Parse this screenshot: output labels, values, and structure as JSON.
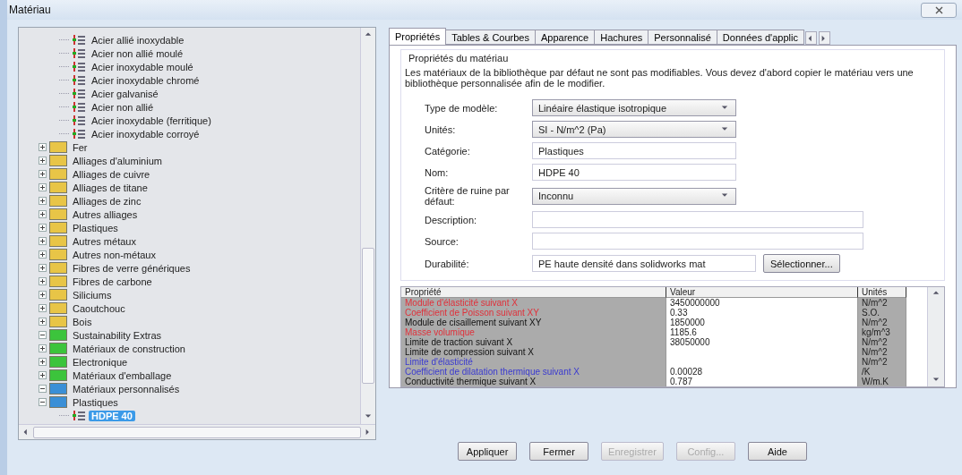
{
  "window": {
    "title": "Matériau"
  },
  "tree": [
    {
      "children": [
        {
          "children": [
            {
              "label": "Acier allié inoxydable",
              "kind": "material",
              "selected": false
            },
            {
              "label": "Acier non allié moulé",
              "kind": "material",
              "selected": false
            },
            {
              "label": "Acier inoxydable moulé",
              "kind": "material",
              "selected": false
            },
            {
              "label": "Acier inoxydable chromé",
              "kind": "material",
              "selected": false
            },
            {
              "label": "Acier galvanisé",
              "kind": "material",
              "selected": false
            },
            {
              "label": "Acier non allié",
              "kind": "material",
              "selected": false
            },
            {
              "label": "Acier inoxydable (ferritique)",
              "kind": "material",
              "selected": false
            },
            {
              "label": "Acier inoxydable corroyé",
              "kind": "material",
              "selected": false
            }
          ]
        },
        {
          "label": "Fer",
          "kind": "folder",
          "color": "#e8c547",
          "expanded": false,
          "selected": false
        },
        {
          "label": "Alliages d'aluminium",
          "kind": "folder",
          "color": "#e8c547",
          "expanded": false,
          "selected": false
        },
        {
          "label": "Alliages de cuivre",
          "kind": "folder",
          "color": "#e8c547",
          "expanded": false,
          "selected": false
        },
        {
          "label": "Alliages de titane",
          "kind": "folder",
          "color": "#e8c547",
          "expanded": false,
          "selected": false
        },
        {
          "label": "Alliages de zinc",
          "kind": "folder",
          "color": "#e8c547",
          "expanded": false,
          "selected": false
        },
        {
          "label": "Autres alliages",
          "kind": "folder",
          "color": "#e8c547",
          "expanded": false,
          "selected": false
        },
        {
          "label": "Plastiques",
          "kind": "folder",
          "color": "#e8c547",
          "expanded": false,
          "selected": false
        },
        {
          "label": "Autres métaux",
          "kind": "folder",
          "color": "#e8c547",
          "expanded": false,
          "selected": false
        },
        {
          "label": "Autres non-métaux",
          "kind": "folder",
          "color": "#e8c547",
          "expanded": false,
          "selected": false
        },
        {
          "label": "Fibres de verre génériques",
          "kind": "folder",
          "color": "#e8c547",
          "expanded": false,
          "selected": false
        },
        {
          "label": "Fibres de carbone",
          "kind": "folder",
          "color": "#e8c547",
          "expanded": false,
          "selected": false
        },
        {
          "label": "Siliciums",
          "kind": "folder",
          "color": "#e8c547",
          "expanded": false,
          "selected": false
        },
        {
          "label": "Caoutchouc",
          "kind": "folder",
          "color": "#e8c547",
          "expanded": false,
          "selected": false
        },
        {
          "label": "Bois",
          "kind": "folder",
          "color": "#e8c547",
          "expanded": false,
          "selected": false
        }
      ]
    },
    {
      "label": "Sustainability Extras",
      "kind": "folder",
      "color": "#3cc43c",
      "expanded": true,
      "selected": false,
      "children": [
        {
          "label": "Matériaux de construction",
          "kind": "folder",
          "color": "#3cc43c",
          "expanded": false,
          "selected": false
        },
        {
          "label": "Electronique",
          "kind": "folder",
          "color": "#3cc43c",
          "expanded": false,
          "selected": false
        },
        {
          "label": "Matériaux d'emballage",
          "kind": "folder",
          "color": "#3cc43c",
          "expanded": false,
          "selected": false
        }
      ]
    },
    {
      "label": "Matériaux personnalisés",
      "kind": "folder",
      "color": "#3a8fd6",
      "expanded": true,
      "selected": false,
      "children": [
        {
          "label": "Plastiques",
          "kind": "folder",
          "color": "#3a8fd6",
          "expanded": true,
          "selected": false,
          "children": [
            {
              "label": "HDPE 40",
              "kind": "material",
              "selected": true
            }
          ]
        }
      ]
    }
  ],
  "tabs": [
    {
      "label": "Propriétés",
      "selected": true
    },
    {
      "label": "Tables & Courbes",
      "selected": false
    },
    {
      "label": "Apparence",
      "selected": false
    },
    {
      "label": "Hachures",
      "selected": false
    },
    {
      "label": "Personnalisé",
      "selected": false
    },
    {
      "label": "Données d'applic",
      "selected": false
    }
  ],
  "group": {
    "title": "Propriétés du matériau",
    "note": "Les matériaux de la bibliothèque par défaut ne sont pas modifiables. Vous devez d'abord copier le matériau vers une bibliothèque personnalisée afin de le modifier."
  },
  "fields": [
    {
      "label": "Type de modèle:",
      "kind": "dropdown",
      "value": "Linéaire élastique isotropique"
    },
    {
      "label": "Unités:",
      "kind": "dropdown",
      "value": "SI - N/m^2 (Pa)"
    },
    {
      "label": "Catégorie:",
      "kind": "text",
      "value": "Plastiques"
    },
    {
      "label": "Nom:",
      "kind": "text",
      "value": "HDPE 40"
    },
    {
      "label": "Critère de ruine par défaut:",
      "kind": "dropdown",
      "value": "Inconnu"
    },
    {
      "label": "Description:",
      "kind": "wide"
    },
    {
      "label": "Source:",
      "kind": "wide"
    },
    {
      "label": "Durabilité:",
      "kind": "browse",
      "value": "PE haute densité dans solidworks mat",
      "button": "Sélectionner..."
    }
  ],
  "table": {
    "columns": [
      "Propriété",
      "Valeur",
      "Unités"
    ],
    "rows": [
      {
        "property": "Module d'élasticité suivant X",
        "value": "3450000000",
        "unit": "N/m^2",
        "color": "#e0303a"
      },
      {
        "property": "Coefficient de Poisson suivant XY",
        "value": "0.33",
        "unit": "S.O.",
        "color": "#e0303a"
      },
      {
        "property": "Module de cisaillement suivant XY",
        "value": "1850000",
        "unit": "N/m^2"
      },
      {
        "property": "Masse volumique",
        "value": "1185.6",
        "unit": "kg/m^3",
        "color": "#e0303a"
      },
      {
        "property": "Limite de traction suivant X",
        "value": "38050000",
        "unit": "N/m^2"
      },
      {
        "property": "Limite de compression suivant X",
        "unit": "N/m^2"
      },
      {
        "property": "Limite d'élasticité",
        "unit": "N/m^2",
        "color": "#3a3ad0"
      },
      {
        "property": "Coefficient de dilatation thermique suivant X",
        "value": "0.00028",
        "unit": "/K",
        "color": "#3a3ad0"
      },
      {
        "property": "Conductivité thermique suivant X",
        "value": "0.787",
        "unit": "W/m.K"
      }
    ]
  },
  "buttons": [
    {
      "label": "Appliquer",
      "disabled": false
    },
    {
      "label": "Fermer",
      "disabled": false
    },
    {
      "label": "Enregistrer",
      "disabled": true
    },
    {
      "label": "Config...",
      "disabled": true
    },
    {
      "label": "Aide",
      "disabled": false
    }
  ]
}
